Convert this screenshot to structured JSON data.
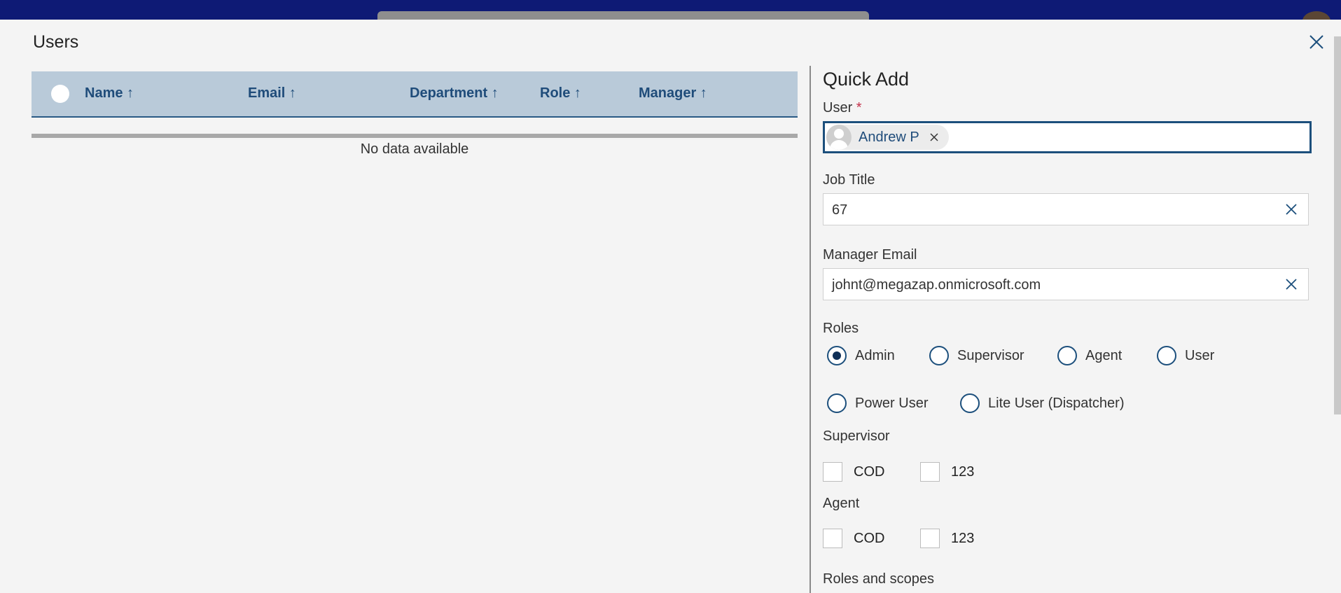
{
  "dialog": {
    "title": "Users"
  },
  "table": {
    "columns": [
      "Name ↑",
      "Email ↑",
      "Department ↑",
      "Role ↑",
      "Manager ↑"
    ],
    "empty_text": "No data available"
  },
  "quick_add": {
    "title": "Quick Add",
    "user": {
      "label": "User",
      "required_mark": "*",
      "selected": "Andrew P"
    },
    "job_title": {
      "label": "Job Title",
      "value": "67"
    },
    "manager_email": {
      "label": "Manager Email",
      "value": "johnt@megazap.onmicrosoft.com"
    },
    "roles": {
      "label": "Roles",
      "options": [
        "Admin",
        "Supervisor",
        "Agent",
        "User",
        "Power User",
        "Lite User (Dispatcher)"
      ],
      "selected": "Admin"
    },
    "supervisor": {
      "label": "Supervisor",
      "options": [
        "COD",
        "123"
      ]
    },
    "agent": {
      "label": "Agent",
      "options": [
        "COD",
        "123"
      ]
    },
    "roles_and_scopes": {
      "label": "Roles and scopes"
    }
  },
  "icons": {
    "close": "close-icon",
    "clear": "clear-icon",
    "avatar": "avatar-icon"
  },
  "colors": {
    "accent": "#1c4f7c",
    "header_bg": "#b9cad9",
    "topbar": "#0e1a75"
  }
}
